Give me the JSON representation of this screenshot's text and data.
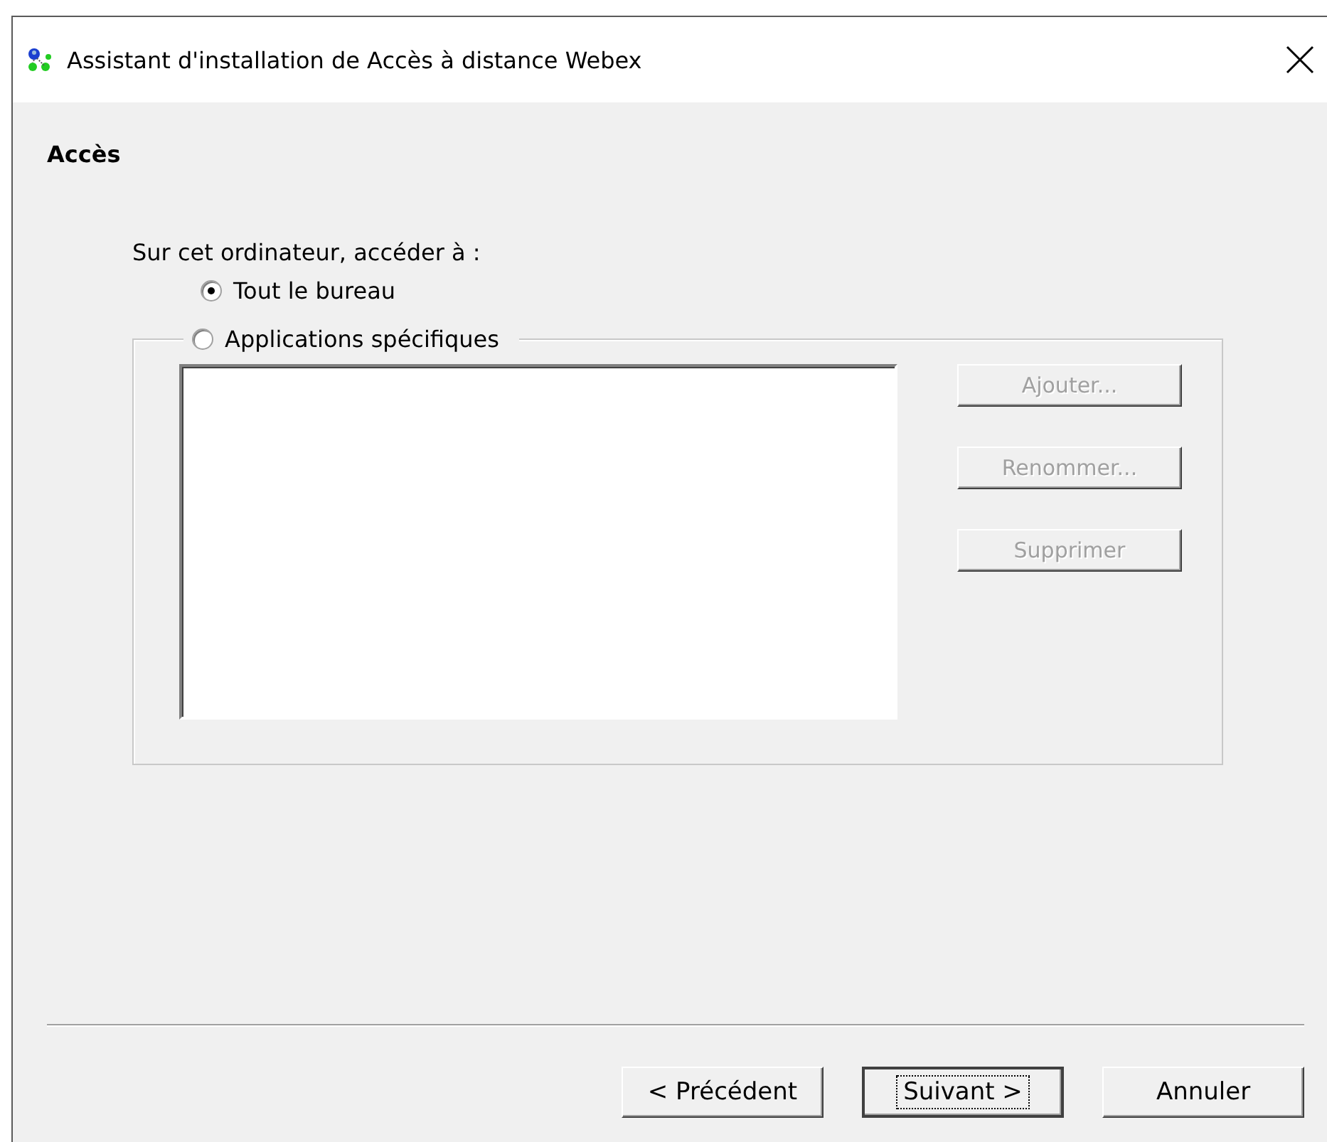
{
  "window": {
    "title": "Assistant d'installation de Accès à distance Webex"
  },
  "page": {
    "heading": "Accès"
  },
  "prompt": "Sur cet ordinateur, accéder à :",
  "options": [
    {
      "label": "Tout le bureau",
      "selected": true
    },
    {
      "label": "Applications spécifiques",
      "selected": false
    }
  ],
  "app_buttons": [
    {
      "label": "Ajouter...",
      "disabled": true
    },
    {
      "label": "Renommer...",
      "disabled": true
    },
    {
      "label": "Supprimer",
      "disabled": true
    }
  ],
  "buttons": [
    {
      "label": "< Précédent",
      "focused": false
    },
    {
      "label": "Suivant >",
      "focused": true
    },
    {
      "label": "Annuler",
      "focused": false
    }
  ]
}
